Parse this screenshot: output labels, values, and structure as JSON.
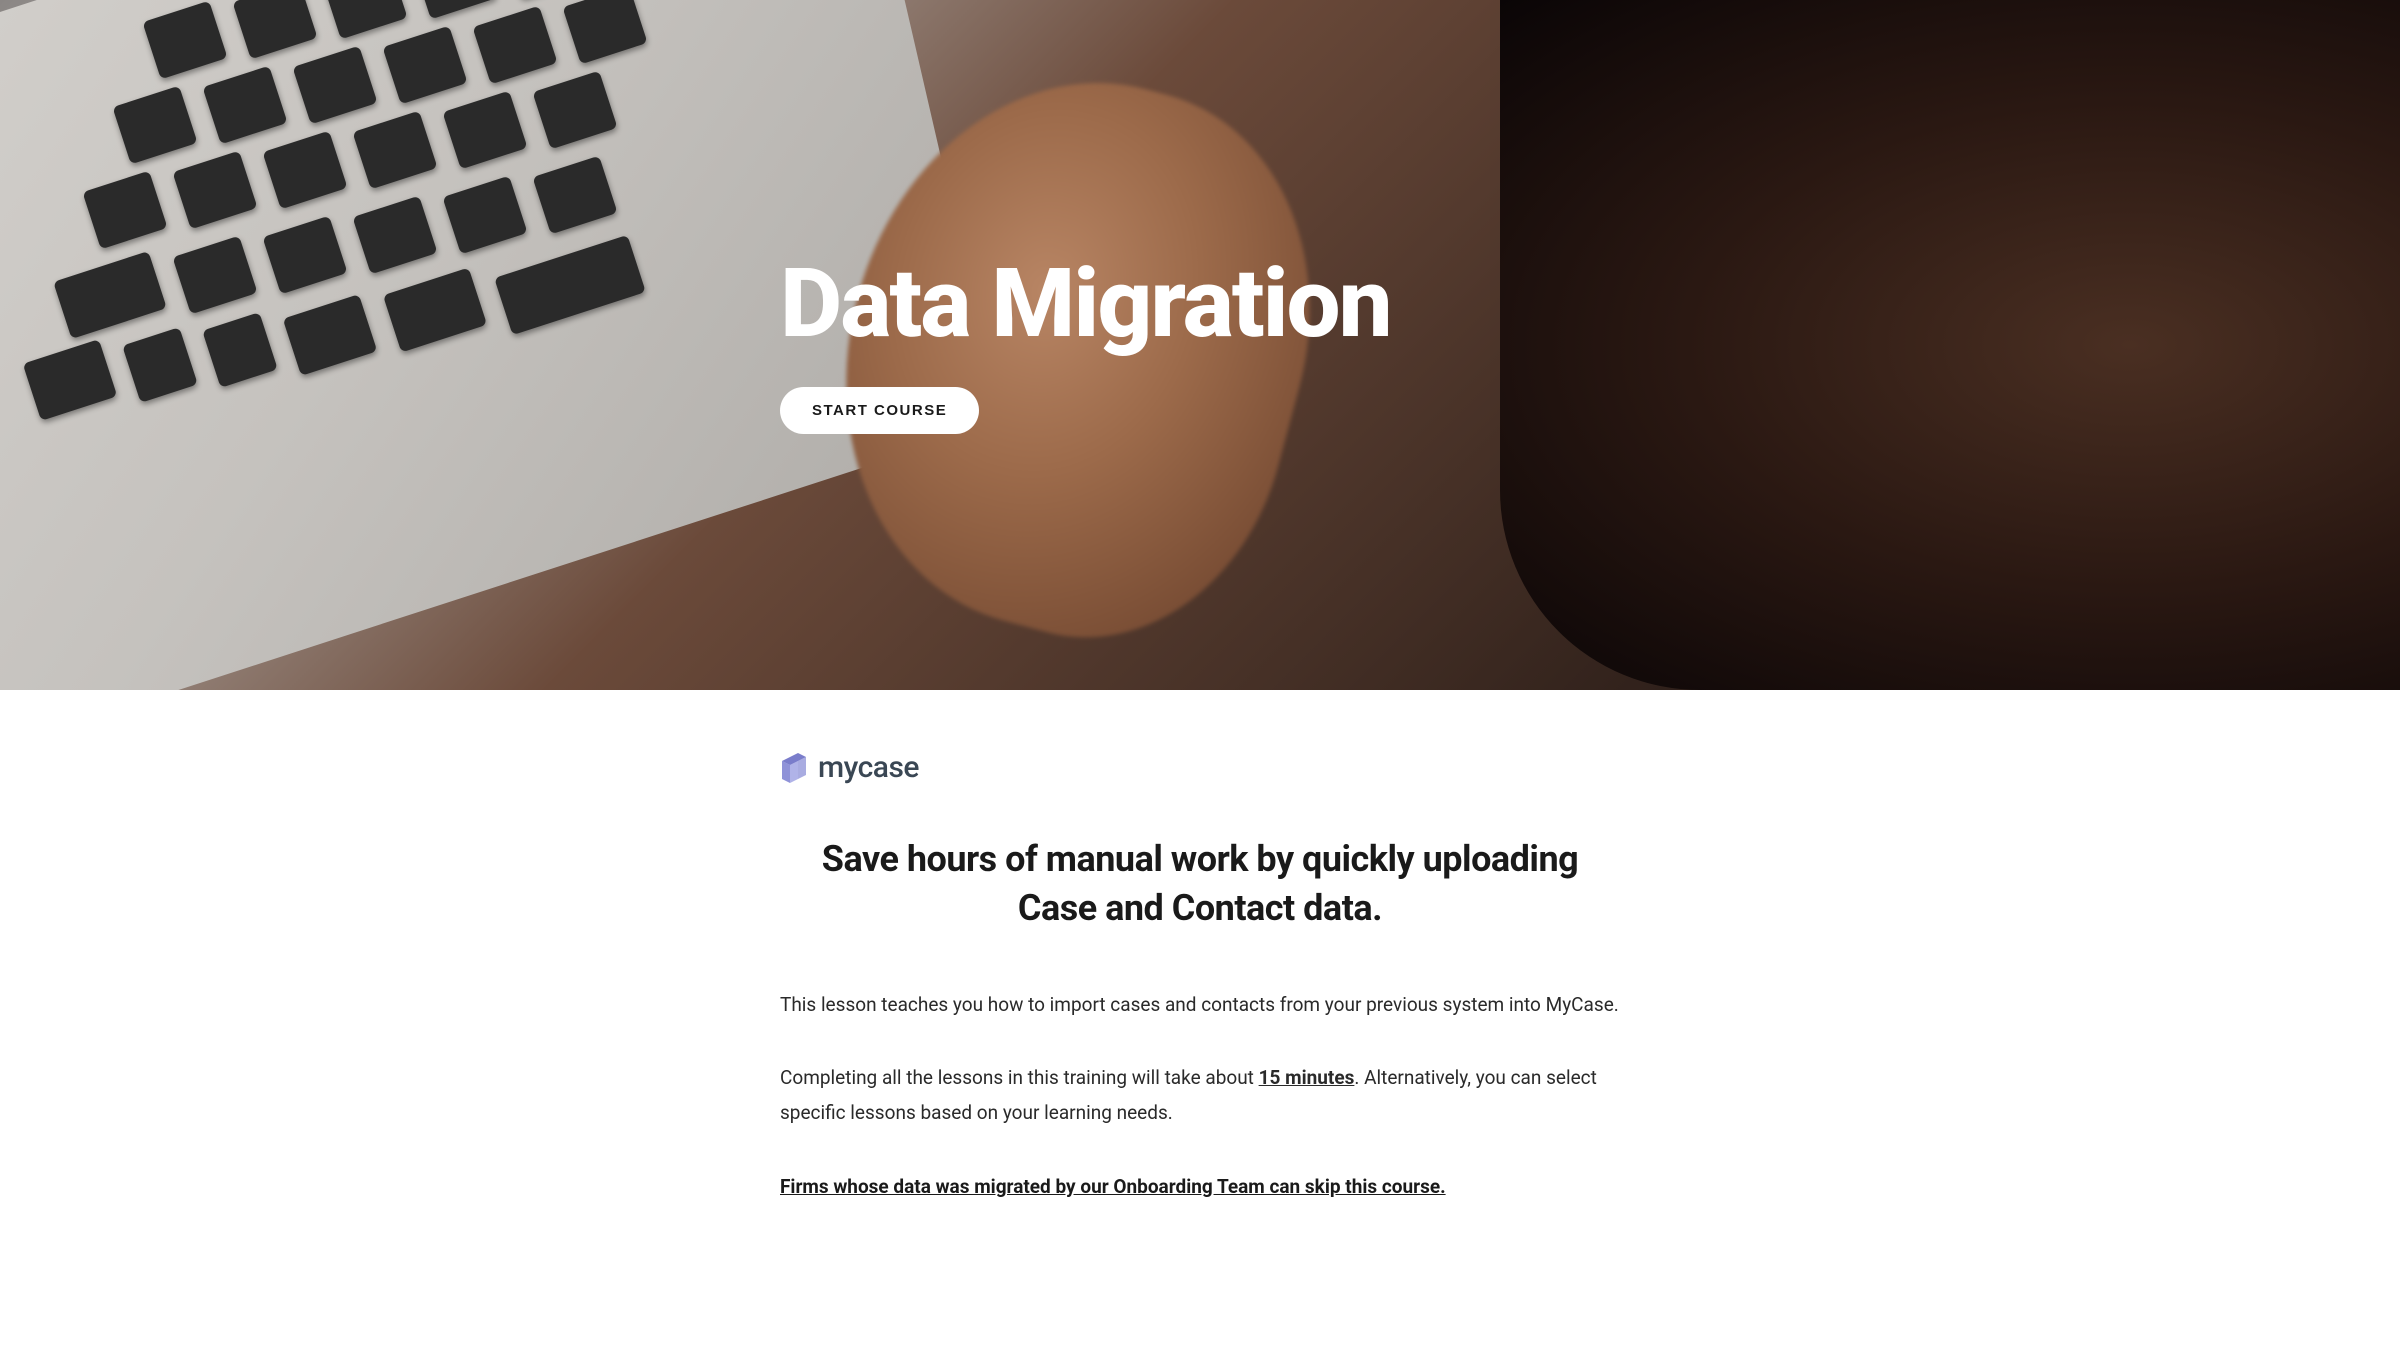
{
  "hero": {
    "title": "Data Migration",
    "button_label": "START COURSE"
  },
  "logo": {
    "text": "mycase"
  },
  "content": {
    "subtitle": "Save hours of manual work by quickly uploading Case and Contact data.",
    "paragraph1": "This lesson teaches you how to import cases and contacts from your previous system into MyCase.",
    "paragraph2_before": "Completing all the lessons in this training will take about ",
    "paragraph2_duration": "15 minutes",
    "paragraph2_after": ". Alternatively, you can select specific lessons based on your learning needs.",
    "skip_notice": "Firms whose data was migrated by our Onboarding Team can skip this course."
  }
}
